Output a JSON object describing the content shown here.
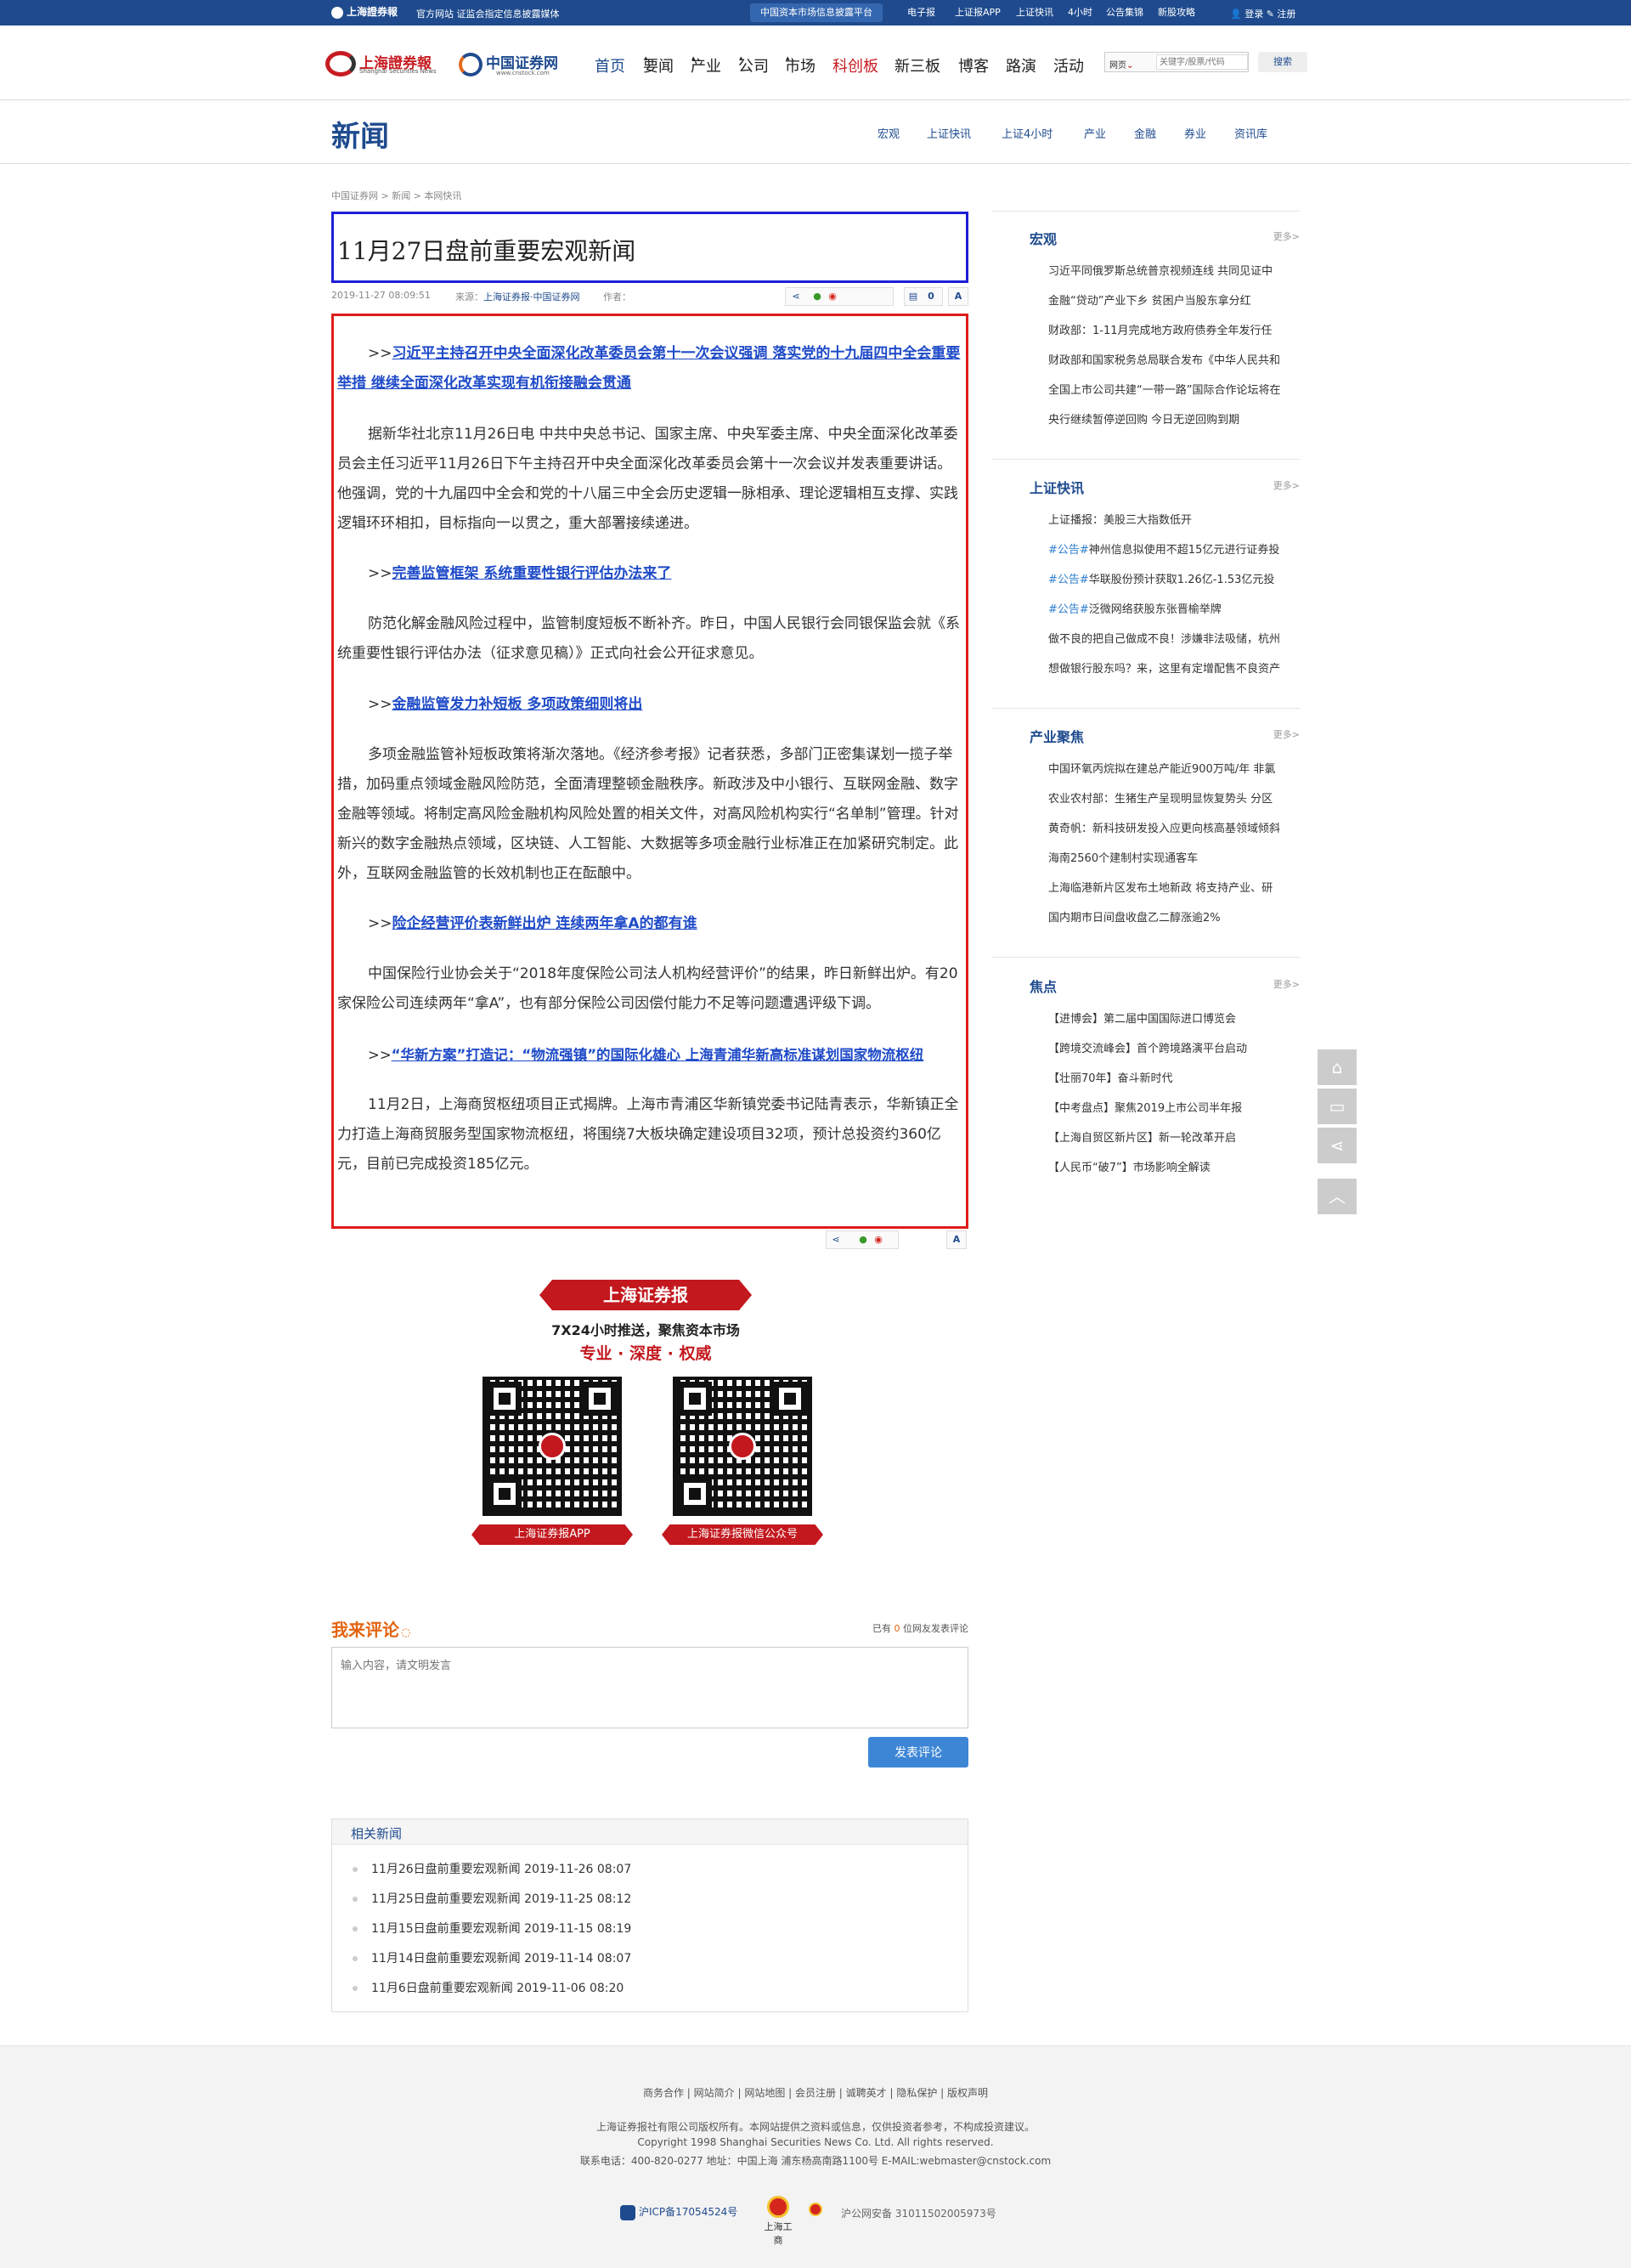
{
  "topbar": {
    "logo": "上海證券報",
    "tagline": "官方网站 证监会指定信息披露媒体",
    "platform": "中国资本市场信息披露平台",
    "links": [
      "电子报",
      "上证报APP",
      "上证快讯",
      "4小时",
      "公告集锦",
      "新股攻略"
    ],
    "login": "登录",
    "register": "注册"
  },
  "header": {
    "logo1_cn": "上海證券報",
    "logo1_en": "Shanghai Securities News",
    "logo2_cn": "中国证券网",
    "logo2_en": "www.cnstock.com",
    "nav": [
      "首页",
      "要闻",
      "产业",
      "公司",
      "市场",
      "科创板",
      "新三板",
      "博客",
      "路演",
      "活动"
    ],
    "search_scope": "网页",
    "search_placeholder": "关键字/股票/代码",
    "search_button": "搜索"
  },
  "channel": {
    "title": "新闻",
    "subnav": [
      "宏观",
      "上证快讯",
      "上证4小时",
      "产业",
      "金融",
      "券业",
      "资讯库"
    ]
  },
  "breadcrumb": "中国证券网 > 新闻 > 本网快讯",
  "article": {
    "title": "11月27日盘前重要宏观新闻",
    "date": "2019-11-27 08:09:51",
    "source_label": "来源：",
    "source": "上海证券报·中国证券网",
    "author_label": "作者：",
    "comment_count": "0",
    "font_label": "A",
    "paragraphs": [
      {
        "prefix": ">>",
        "link": "习近平主持召开中央全面深化改革委员会第十一次会议强调 落实党的十九届四中全会重要举措 继续全面深化改革实现有机衔接融会贯通"
      },
      {
        "text": "据新华社北京11月26日电 中共中央总书记、国家主席、中央军委主席、中央全面深化改革委员会主任习近平11月26日下午主持召开中央全面深化改革委员会第十一次会议并发表重要讲话。他强调，党的十九届四中全会和党的十八届三中全会历史逻辑一脉相承、理论逻辑相互支撑、实践逻辑环环相扣，目标指向一以贯之，重大部署接续递进。"
      },
      {
        "prefix": ">>",
        "link": "完善监管框架 系统重要性银行评估办法来了 "
      },
      {
        "text": "防范化解金融风险过程中，监管制度短板不断补齐。昨日，中国人民银行会同银保监会就《系统重要性银行评估办法（征求意见稿）》正式向社会公开征求意见。"
      },
      {
        "prefix": ">>",
        "link": "金融监管发力补短板 多项政策细则将出"
      },
      {
        "text": "多项金融监管补短板政策将渐次落地。《经济参考报》记者获悉，多部门正密集谋划一揽子举措，加码重点领域金融风险防范，全面清理整顿金融秩序。新政涉及中小银行、互联网金融、数字金融等领域。将制定高风险金融机构风险处置的相关文件，对高风险机构实行“名单制”管理。针对新兴的数字金融热点领域，区块链、人工智能、大数据等多项金融行业标准正在加紧研究制定。此外，互联网金融监管的长效机制也正在酝酿中。"
      },
      {
        "prefix": ">>",
        "link": "险企经营评价表新鲜出炉 连续两年拿A的都有谁"
      },
      {
        "text": "中国保险行业协会关于“2018年度保险公司法人机构经营评价”的结果，昨日新鲜出炉。有20家保险公司连续两年“拿A”，也有部分保险公司因偿付能力不足等问题遭遇评级下调。"
      },
      {
        "prefix": ">>",
        "link": "“华新方案”打造记：“物流强镇”的国际化雄心 上海青浦华新高标准谋划国家物流枢纽"
      },
      {
        "text": "11月2日，上海商贸枢纽项目正式揭牌。上海市青浦区华新镇党委书记陆青表示，华新镇正全力打造上海商贸服务型国家物流枢纽，将围绕7大板块确定建设项目32项，预计总投资约360亿元，目前已完成投资185亿元。"
      }
    ]
  },
  "ad": {
    "ribbon": "上海证券报",
    "line1": "7X24小时推送，聚焦资本市场",
    "line2": "专业 · 深度 · 权威",
    "qr1_label": "上海证券报APP",
    "qr2_label": "上海证券报微信公众号"
  },
  "comments": {
    "title": "我来评论",
    "count_prefix": "已有",
    "count": "0",
    "count_suffix": "位网友发表评论",
    "placeholder": "输入内容，请文明发言",
    "submit": "发表评论"
  },
  "related": {
    "title": "相关新闻",
    "items": [
      "11月26日盘前重要宏观新闻 2019-11-26 08:07",
      "11月25日盘前重要宏观新闻 2019-11-25 08:12",
      "11月15日盘前重要宏观新闻 2019-11-15 08:19",
      "11月14日盘前重要宏观新闻 2019-11-14 08:07",
      "11月6日盘前重要宏观新闻 2019-11-06 08:20"
    ]
  },
  "sidebar": {
    "more": "更多>",
    "sections": [
      {
        "title": "宏观",
        "items": [
          "习近平同俄罗斯总统普京视频连线 共同见证中",
          "金融“贷动”产业下乡 贫困户当股东拿分红",
          "财政部：1-11月完成地方政府债券全年发行任",
          "财政部和国家税务总局联合发布《中华人民共和",
          "全国上市公司共建“一带一路”国际合作论坛将在",
          "央行继续暂停逆回购 今日无逆回购到期"
        ]
      },
      {
        "title": "上证快讯",
        "items": [
          "上证播报：美股三大指数低开",
          "神州信息拟使用不超15亿元进行证券投",
          "华联股份预计获取1.26亿-1.53亿元投",
          "泛微网络获股东张晋榆举牌",
          "做不良的把自己做成不良！涉嫌非法吸储，杭州",
          "想做银行股东吗？来，这里有定增配售不良资产"
        ],
        "tag": "#公告#"
      },
      {
        "title": "产业聚焦",
        "items": [
          "中国环氧丙烷拟在建总产能近900万吨/年 非氯",
          "农业农村部：生猪生产呈现明显恢复势头 分区",
          "黄奇帆：新科技研发投入应更向核高基领域倾斜",
          "海南2560个建制村实现通客车",
          "上海临港新片区发布土地新政 将支持产业、研",
          "国内期市日间盘收盘乙二醇涨逾2%"
        ]
      },
      {
        "title": "焦点",
        "items": [
          "【进博会】第二届中国国际进口博览会",
          "【跨境交流峰会】首个跨境路演平台启动",
          "【壮丽70年】奋斗新时代",
          "【中考盘点】聚焦2019上市公司半年报",
          "【上海自贸区新片区】新一轮改革开启",
          "【人民币“破7”】市场影响全解读"
        ]
      }
    ]
  },
  "float_tools": [
    "home-icon",
    "comment-icon",
    "share-icon",
    "top-icon"
  ],
  "footer": {
    "links": "商务合作 | 网站简介 | 网站地图 | 会员注册 | 诚聘英才 | 隐私保护 | 版权声明",
    "copy1": "上海证券报社有限公司版权所有。本网站提供之资料或信息，仅供投资者参考，不构成投资建议。",
    "copy2": "Copyright 1998 Shanghai Securities News Co. Ltd. All rights reserved.",
    "copy3": "联系电话：400-820-0277 地址：中国上海 浦东杨高南路1100号 E-MAIL:webmaster@cnstock.com",
    "icp": "沪ICP备17054524号",
    "gs": "上海工商",
    "psb": "沪公网安备 31011502005973号"
  }
}
